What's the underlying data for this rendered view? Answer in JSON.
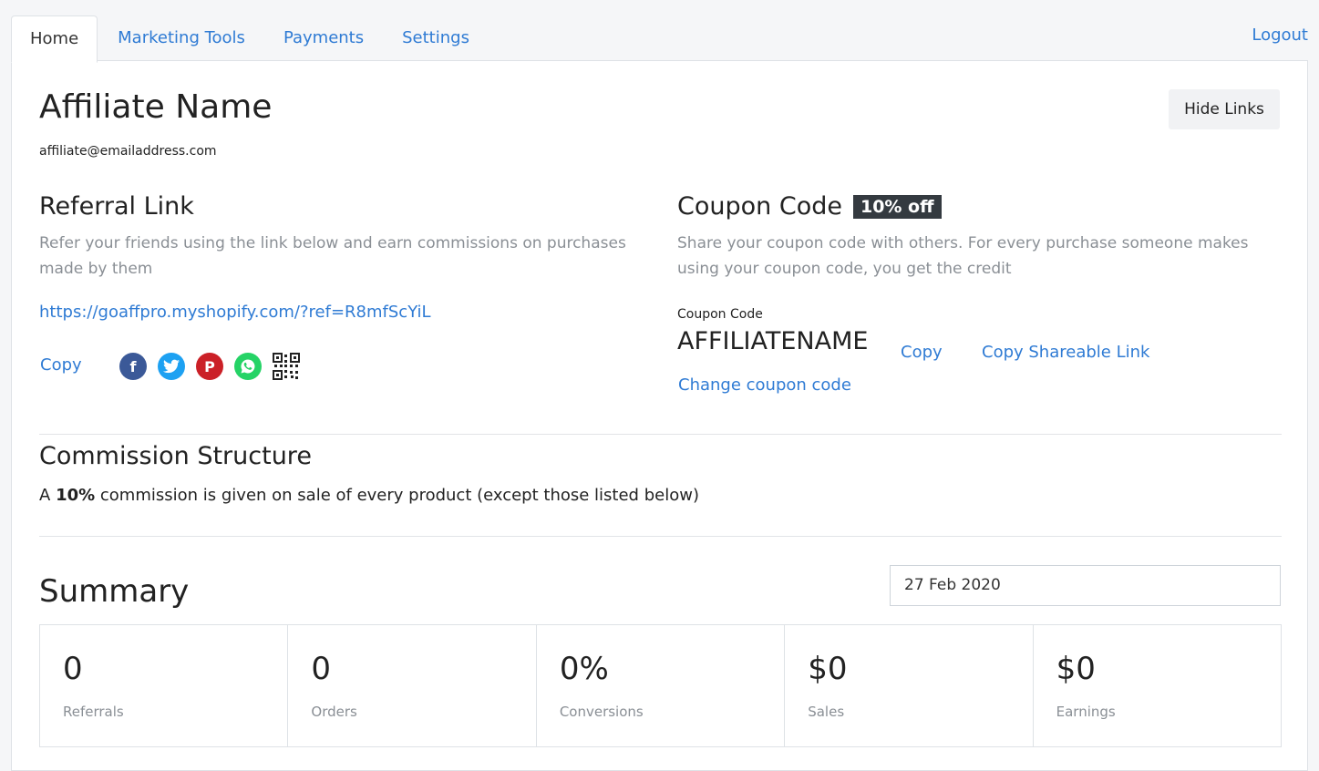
{
  "tabs": [
    {
      "label": "Home",
      "active": true
    },
    {
      "label": "Marketing Tools"
    },
    {
      "label": "Payments"
    },
    {
      "label": "Settings"
    }
  ],
  "logout_label": "Logout",
  "affiliate": {
    "name": "Affiliate Name",
    "email": "affiliate@emailaddress.com",
    "hide_links_label": "Hide Links"
  },
  "referral": {
    "title": "Referral Link",
    "description": "Refer your friends using the link below and earn commissions on purchases made by them",
    "url": "https://goaffpro.myshopify.com/?ref=R8mfScYiL",
    "copy_label": "Copy",
    "share_icons": [
      "facebook-icon",
      "twitter-icon",
      "pinterest-icon",
      "whatsapp-icon",
      "qr-code-icon"
    ]
  },
  "coupon": {
    "title": "Coupon Code",
    "badge": "10% off",
    "description": "Share your coupon code with others. For every purchase someone makes using your coupon code, you get the credit",
    "label": "Coupon Code",
    "code": "AFFILIATENAME",
    "copy_label": "Copy",
    "share_label": "Copy Shareable Link",
    "change_label": "Change coupon code"
  },
  "commission": {
    "title": "Commission Structure",
    "prefix": "A",
    "rate": "10%",
    "suffix": "commission is given on sale of every product (except those listed below)"
  },
  "summary": {
    "title": "Summary",
    "date": "27 Feb 2020",
    "stats": [
      {
        "value": "0",
        "label": "Referrals"
      },
      {
        "value": "0",
        "label": "Orders"
      },
      {
        "value": "0%",
        "label": "Conversions"
      },
      {
        "value": "$0",
        "label": "Sales"
      },
      {
        "value": "$0",
        "label": "Earnings"
      }
    ]
  },
  "colors": {
    "accent": "#2f7bd4",
    "badge_bg": "#343a40"
  }
}
